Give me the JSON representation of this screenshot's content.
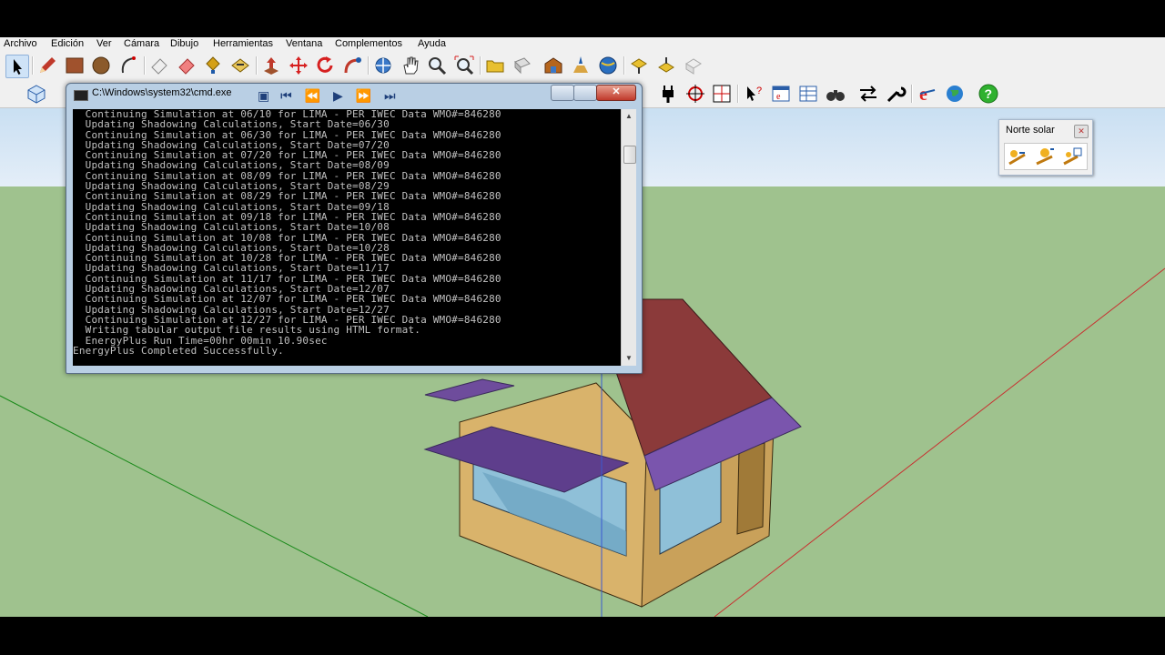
{
  "menu": [
    "Archivo",
    "Edición",
    "Ver",
    "Cámara",
    "Dibujo",
    "Herramientas",
    "Ventana",
    "Complementos",
    "Ayuda"
  ],
  "toolbar_row1": [
    "select-icon",
    "pencil-icon",
    "rectangle-icon",
    "circle-icon",
    "arc-icon",
    "eraser-outline-icon",
    "eraser-icon",
    "paint-bucket-icon",
    "push-pull-icon",
    "move-icon",
    "rotate-icon",
    "follow-me-icon",
    "offset-icon",
    "orbit-icon",
    "pan-icon",
    "zoom-icon",
    "zoom-extents-icon",
    "folder-icon",
    "component-icon",
    "warehouse-icon",
    "location-icon",
    "globe-icon",
    "import-icon",
    "export-icon",
    "model-icon"
  ],
  "toolbar_row2": [
    "iso-view-icon",
    "plug-icon",
    "target-icon",
    "grid-icon",
    "help-cursor-icon",
    "browser-icon",
    "table-icon",
    "binoculars-icon",
    "arrows-icon",
    "wrench-icon",
    "ie-icon",
    "earth-icon",
    "help-icon"
  ],
  "cmd_window": {
    "title": "C:\\Windows\\system32\\cmd.exe",
    "lines": [
      "  Continuing Simulation at 06/10 for LIMA - PER IWEC Data WMO#=846280",
      "  Updating Shadowing Calculations, Start Date=06/30",
      "  Continuing Simulation at 06/30 for LIMA - PER IWEC Data WMO#=846280",
      "  Updating Shadowing Calculations, Start Date=07/20",
      "  Continuing Simulation at 07/20 for LIMA - PER IWEC Data WMO#=846280",
      "  Updating Shadowing Calculations, Start Date=08/09",
      "  Continuing Simulation at 08/09 for LIMA - PER IWEC Data WMO#=846280",
      "  Updating Shadowing Calculations, Start Date=08/29",
      "  Continuing Simulation at 08/29 for LIMA - PER IWEC Data WMO#=846280",
      "  Updating Shadowing Calculations, Start Date=09/18",
      "  Continuing Simulation at 09/18 for LIMA - PER IWEC Data WMO#=846280",
      "  Updating Shadowing Calculations, Start Date=10/08",
      "  Continuing Simulation at 10/08 for LIMA - PER IWEC Data WMO#=846280",
      "  Updating Shadowing Calculations, Start Date=10/28",
      "  Continuing Simulation at 10/28 for LIMA - PER IWEC Data WMO#=846280",
      "  Updating Shadowing Calculations, Start Date=11/17",
      "  Continuing Simulation at 11/17 for LIMA - PER IWEC Data WMO#=846280",
      "  Updating Shadowing Calculations, Start Date=12/07",
      "  Continuing Simulation at 12/07 for LIMA - PER IWEC Data WMO#=846280",
      "  Updating Shadowing Calculations, Start Date=12/27",
      "  Continuing Simulation at 12/27 for LIMA - PER IWEC Data WMO#=846280",
      "  Writing tabular output file results using HTML format.",
      "  EnergyPlus Run Time=00hr 00min 10.90sec",
      "EnergyPlus Completed Successfully."
    ]
  },
  "norte_solar": {
    "title": "Norte solar",
    "tools": [
      "sun-north-icon",
      "sun-angle-icon",
      "sun-chart-icon"
    ]
  },
  "colors": {
    "sky": "#d4e6f5",
    "ground": "#9fc28e",
    "wall": "#d9b36b",
    "roof": "#8b3a3a",
    "shade": "#6e4c9c",
    "glass": "#8fc0d8"
  }
}
